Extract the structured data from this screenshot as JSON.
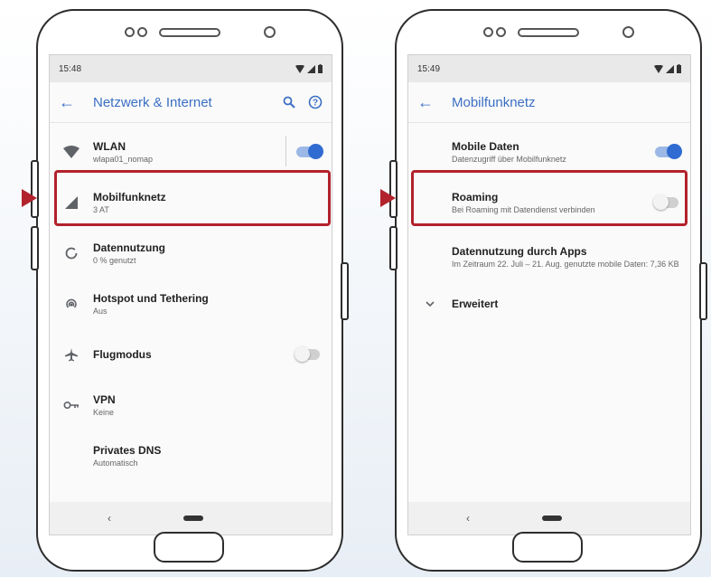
{
  "colors": {
    "accent": "#3b6fc4",
    "toggle_on": "#2f6bd1",
    "highlight": "#b2222c"
  },
  "left_phone": {
    "status_time": "15:48",
    "title": "Netzwerk & Internet",
    "actions": [
      "search-icon",
      "help-icon"
    ],
    "items": [
      {
        "icon": "wifi-icon",
        "title": "WLAN",
        "subtitle": "wlapa01_nomap",
        "toggle": "on"
      },
      {
        "icon": "signal-icon",
        "title": "Mobilfunknetz",
        "subtitle": "3 AT"
      },
      {
        "icon": "data-usage-icon",
        "title": "Datennutzung",
        "subtitle": "0 % genutzt"
      },
      {
        "icon": "hotspot-icon",
        "title": "Hotspot und Tethering",
        "subtitle": "Aus"
      },
      {
        "icon": "airplane-icon",
        "title": "Flugmodus",
        "toggle": "off"
      },
      {
        "icon": "vpn-key-icon",
        "title": "VPN",
        "subtitle": "Keine"
      },
      {
        "icon": "",
        "title": "Privates DNS",
        "subtitle": "Automatisch"
      }
    ]
  },
  "right_phone": {
    "status_time": "15:49",
    "title": "Mobilfunknetz",
    "items": [
      {
        "title": "Mobile Daten",
        "subtitle": "Datenzugriff über Mobilfunknetz",
        "toggle": "on"
      },
      {
        "title": "Roaming",
        "subtitle": "Bei Roaming mit Datendienst verbinden",
        "toggle": "off"
      },
      {
        "title": "Datennutzung durch Apps",
        "subtitle": "Im Zeitraum 22. Juli – 21. Aug. genutzte mobile Daten: 7,36 KB"
      },
      {
        "icon": "chevron-down-icon",
        "title": "Erweitert"
      }
    ]
  }
}
